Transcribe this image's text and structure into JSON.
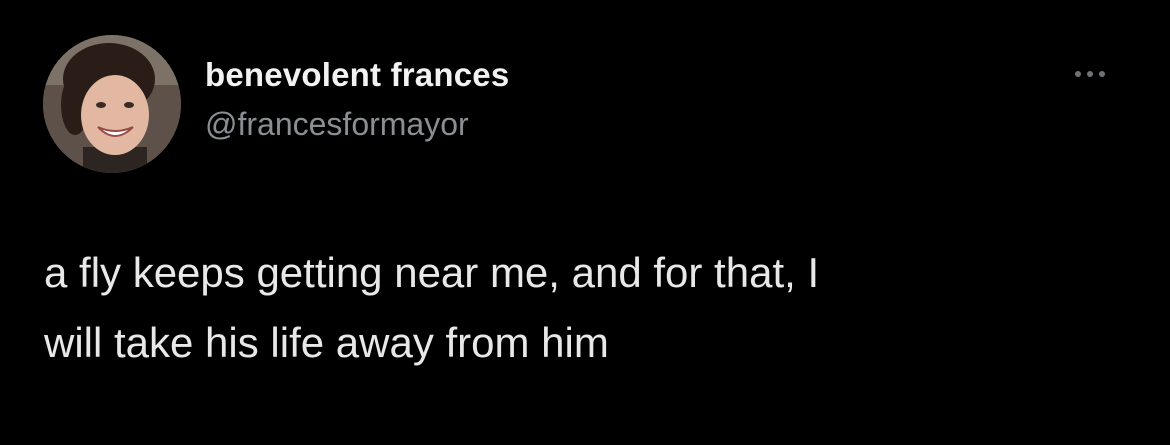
{
  "author": {
    "display_name": "benevolent frances",
    "handle": "@francesformayor",
    "avatar_icon": "profile-photo"
  },
  "menu": {
    "icon": "more-options-icon"
  },
  "tweet": {
    "lines": [
      "a fly keeps getting near me, and for that, I",
      "will take his life away from him"
    ]
  },
  "colors": {
    "background": "#000000",
    "name": "#f2f2f2",
    "handle": "#8b8f94",
    "body": "#e8e8e8"
  }
}
